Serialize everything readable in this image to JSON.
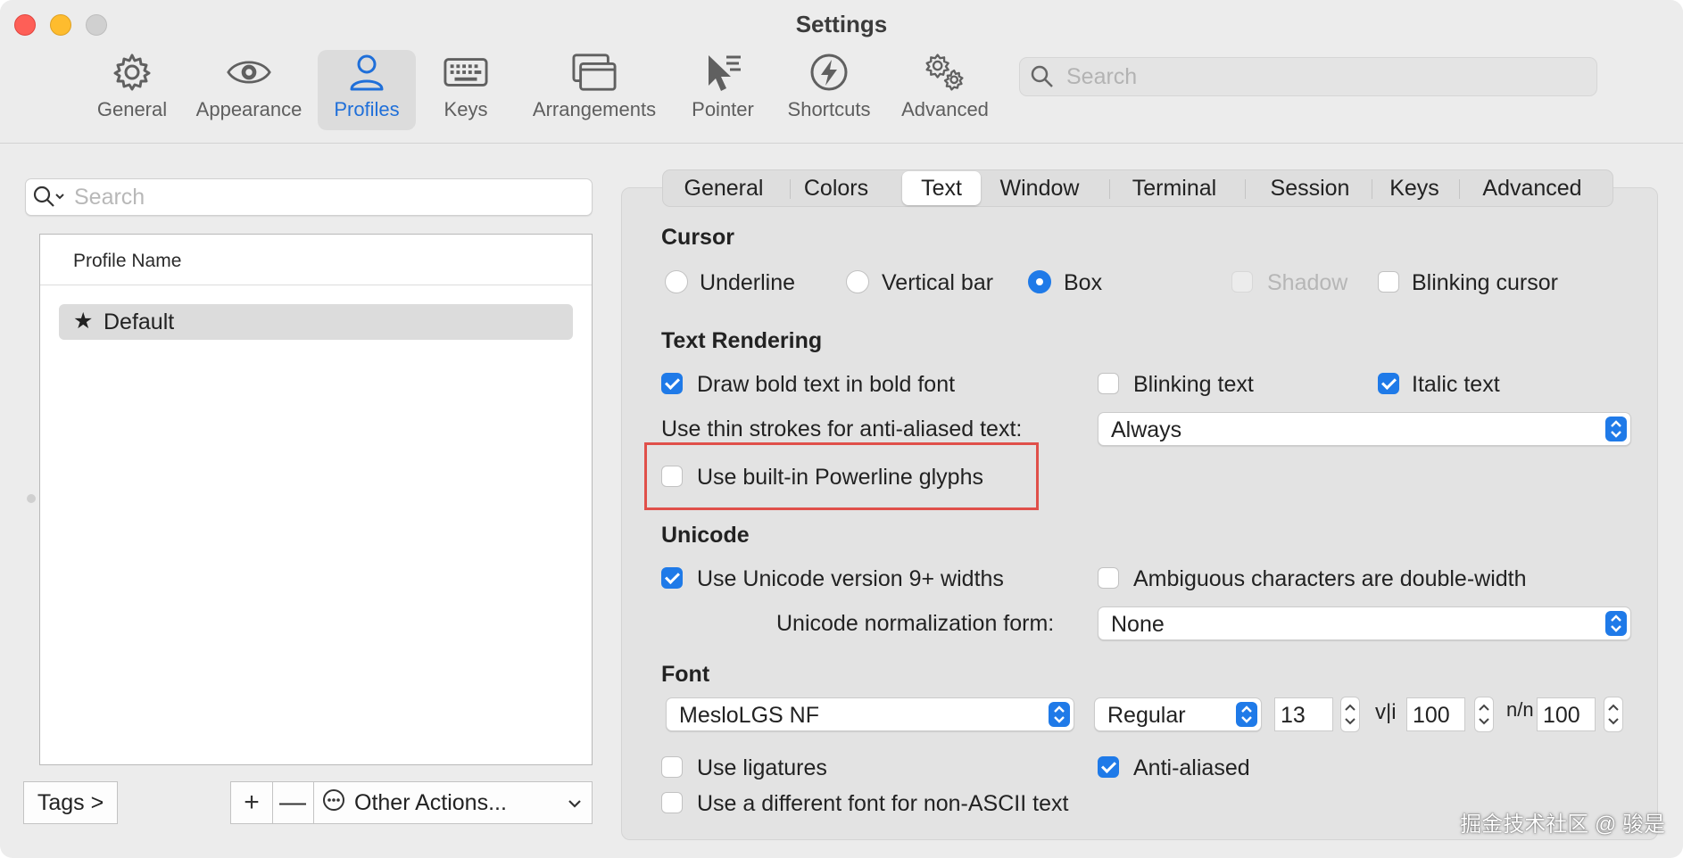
{
  "window": {
    "title": "Settings"
  },
  "toolbar": {
    "items": [
      {
        "label": "General",
        "icon": "gear-icon"
      },
      {
        "label": "Appearance",
        "icon": "eye-icon"
      },
      {
        "label": "Profiles",
        "icon": "person-icon",
        "selected": true
      },
      {
        "label": "Keys",
        "icon": "keyboard-icon"
      },
      {
        "label": "Arrangements",
        "icon": "windows-icon"
      },
      {
        "label": "Pointer",
        "icon": "pointer-icon"
      },
      {
        "label": "Shortcuts",
        "icon": "bolt-icon"
      },
      {
        "label": "Advanced",
        "icon": "gears-icon"
      }
    ],
    "search_placeholder": "Search"
  },
  "profiles": {
    "search_placeholder": "Search",
    "column_header": "Profile Name",
    "rows": [
      {
        "name": "Default",
        "is_default": true
      }
    ],
    "tags_button": "Tags >",
    "add_button": "+",
    "remove_button": "—",
    "other_actions": "Other Actions..."
  },
  "tabs": [
    "General",
    "Colors",
    "Text",
    "Window",
    "Terminal",
    "Session",
    "Keys",
    "Advanced"
  ],
  "active_tab": "Text",
  "cursor": {
    "title": "Cursor",
    "options": [
      "Underline",
      "Vertical bar",
      "Box"
    ],
    "selected": "Box",
    "shadow": {
      "label": "Shadow",
      "checked": false,
      "disabled": true
    },
    "blinking": {
      "label": "Blinking cursor",
      "checked": false
    }
  },
  "text_rendering": {
    "title": "Text Rendering",
    "bold": {
      "label": "Draw bold text in bold font",
      "checked": true
    },
    "blinking_text": {
      "label": "Blinking text",
      "checked": false
    },
    "italic": {
      "label": "Italic text",
      "checked": true
    },
    "thin_strokes_label": "Use thin strokes for anti-aliased text:",
    "thin_strokes_value": "Always",
    "powerline": {
      "label": "Use built-in Powerline glyphs",
      "checked": false
    }
  },
  "unicode": {
    "title": "Unicode",
    "widths": {
      "label": "Use Unicode version 9+ widths",
      "checked": true
    },
    "ambiguous": {
      "label": "Ambiguous characters are double-width",
      "checked": false
    },
    "normalization_label": "Unicode normalization form:",
    "normalization_value": "None"
  },
  "font": {
    "title": "Font",
    "family": "MesloLGS NF",
    "style": "Regular",
    "size": "13",
    "hspacing_glyph": "v|i",
    "hspacing": "100",
    "vspacing_glyph": "n/n",
    "vspacing": "100",
    "ligatures": {
      "label": "Use ligatures",
      "checked": false
    },
    "antialiased": {
      "label": "Anti-aliased",
      "checked": true
    },
    "non_ascii": {
      "label": "Use a different font for non-ASCII text",
      "checked": false
    }
  },
  "watermark": "掘金技术社区 @ 骏是",
  "colors": {
    "accent": "#1f7ae8",
    "selected_tool": "#1f6fd9",
    "highlight_box": "#e0504a"
  }
}
